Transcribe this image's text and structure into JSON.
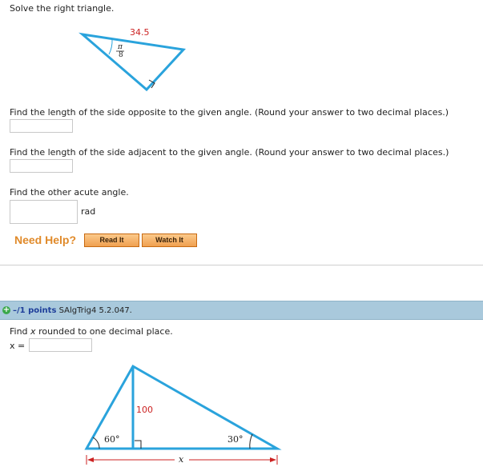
{
  "q1": {
    "prompt": "Solve the right triangle.",
    "hyp_label": "34.5",
    "angle_num": "π",
    "angle_den": "8",
    "sub1": "Find the length of the side opposite to the given angle. (Round your answer to two decimal places.)",
    "sub2": "Find the length of the side adjacent to the given angle. (Round your answer to two decimal places.)",
    "sub3": "Find the other acute angle.",
    "unit": "rad",
    "help_title": "Need Help?",
    "read_it": "Read It",
    "watch_it": "Watch It"
  },
  "q2": {
    "points": "–/1 points",
    "code": "SAlgTrig4 5.2.047.",
    "prompt_prefix": "Find",
    "prompt_var": "x",
    "prompt_suffix": "rounded to one decimal place.",
    "x_label": "x =",
    "height_label": "100",
    "angle_left": "60°",
    "angle_right": "30°",
    "base_label": "x"
  },
  "colors": {
    "triangle": "#2aa3dc",
    "red": "#cc2222",
    "help": "#e08a2a",
    "points_bar": "#a9c9dc"
  }
}
